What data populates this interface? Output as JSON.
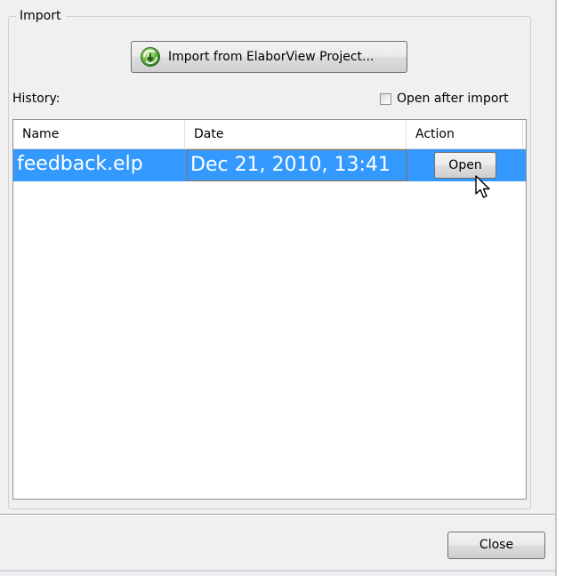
{
  "import_group": {
    "title": "Import",
    "import_button_label": "Import from ElaborView Project...",
    "import_icon": "import-project-icon"
  },
  "history": {
    "label": "History:",
    "open_after_import": {
      "label": "Open after import",
      "checked": false
    }
  },
  "table": {
    "columns": [
      "Name",
      "Date",
      "Action"
    ],
    "rows": [
      {
        "name": "feedback.elp",
        "date": "Dec 21, 2010, 13:41",
        "action_label": "Open",
        "selected": true
      }
    ]
  },
  "footer": {
    "close_label": "Close"
  },
  "colors": {
    "selection": "#3399ff",
    "dialog_bg": "#f0f0f0"
  }
}
